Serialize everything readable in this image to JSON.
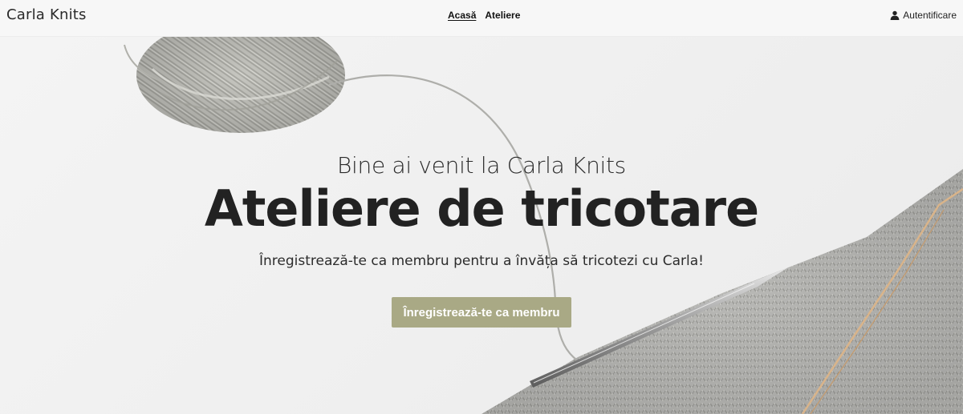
{
  "navbar": {
    "brand": "Carla Knits",
    "links": [
      {
        "label": "Acasă",
        "active": true
      },
      {
        "label": "Ateliere",
        "active": false
      }
    ],
    "login_label": "Autentificare",
    "login_icon": "user-icon"
  },
  "hero": {
    "subtitle": "Bine ai venit la Carla Knits",
    "title": "Ateliere de tricotare",
    "text": "Înregistrează-te ca membru pentru a învăța să tricotezi cu Carla!",
    "cta_label": "Înregistrează-te ca membru",
    "background_image": "yarn-and-knitting-needle"
  },
  "colors": {
    "navbar_bg": "#f7f7f7",
    "cta_bg": "#a9a985",
    "cta_text": "#ffffff",
    "text_dark": "#222222"
  }
}
